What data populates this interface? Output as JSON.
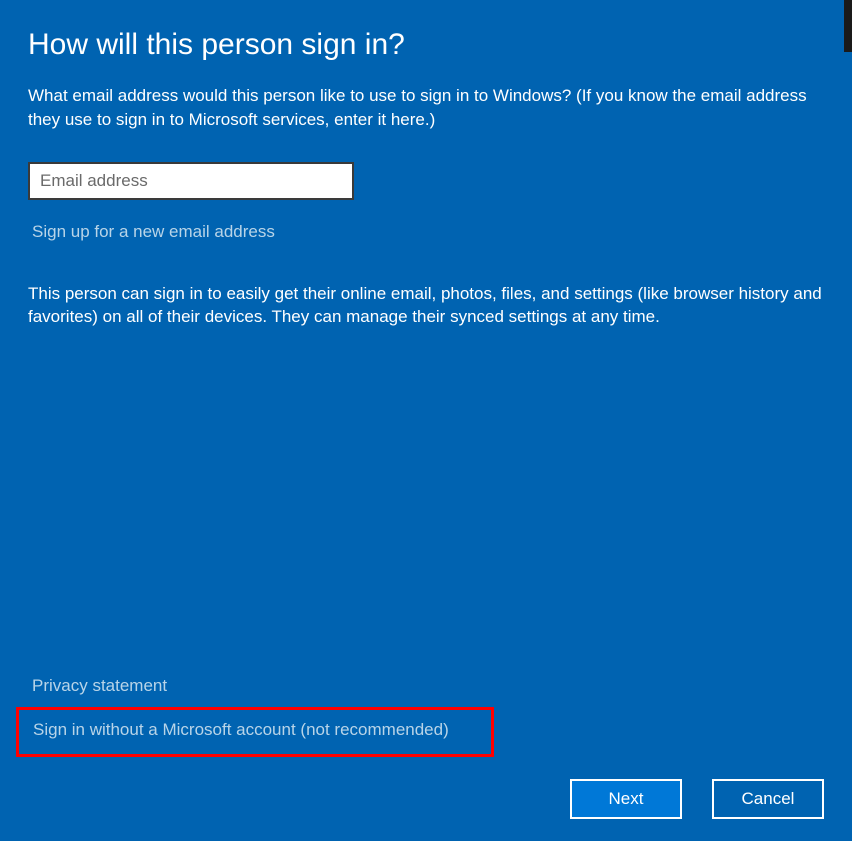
{
  "title": "How will this person sign in?",
  "subtitle": "What email address would this person like to use to sign in to Windows? (If you know the email address they use to sign in to Microsoft services, enter it here.)",
  "email_placeholder": "Email address",
  "email_value": "",
  "signup_link": "Sign up for a new email address",
  "description": "This person can sign in to easily get their online email, photos, files, and settings (like browser history and favorites) on all of their devices. They can manage their synced settings at any time.",
  "privacy_link": "Privacy statement",
  "signin_without_link": "Sign in without a Microsoft account (not recommended)",
  "buttons": {
    "next": "Next",
    "cancel": "Cancel"
  }
}
